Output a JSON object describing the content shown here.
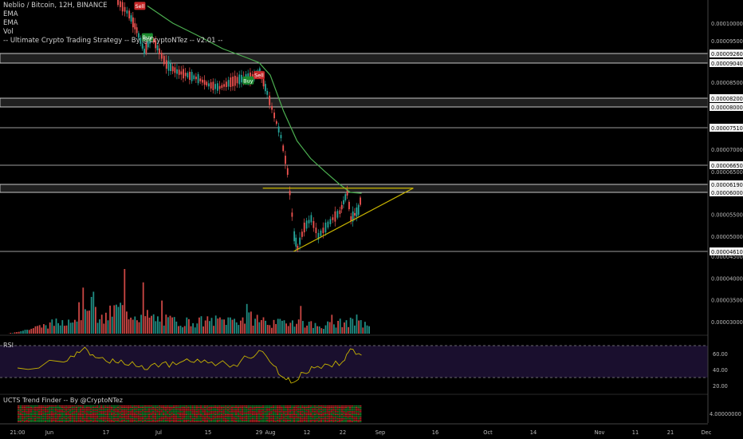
{
  "legend": {
    "symbol": "Neblio / Bitcoin, 12H, BINANCE",
    "ema1": "EMA",
    "ema2": "EMA",
    "vol": "Vol",
    "strategy": "-- Ultimate Crypto Trading Strategy -- By @CryptoNTez -- v2.01 --"
  },
  "rsi_label": "RSI",
  "trend_label": "UCTS Trend Finder -- By @CryptoNTez",
  "colors": {
    "up": "#26a69a",
    "down": "#ef5350",
    "ema": "#4caf50",
    "triangle": "#c8b400",
    "rsi": "#c8b400",
    "rsi_band": "#1a0f2e",
    "zone": "#b0b0b0",
    "buy": "#1b8a2e",
    "sell": "#c62828"
  },
  "chart_data": [
    {
      "type": "candlestick",
      "title": "Neblio / Bitcoin, 12H, BINANCE",
      "x_ticks": [
        "21:00",
        "Jun",
        "17",
        "Jul",
        "15",
        "29",
        "Aug",
        "12",
        "22",
        "Sep",
        "16",
        "Oct",
        "14",
        "Nov",
        "11",
        "21",
        "Dec"
      ],
      "y_ticks": [
        "0.00010000",
        "0.00009500",
        "0.00009260",
        "0.00009040",
        "0.00008500",
        "0.00008200",
        "0.00008000",
        "0.00007510",
        "0.00007000",
        "0.00006650",
        "0.00006500",
        "0.00006190",
        "0.00006000",
        "0.00005500",
        "0.00005000",
        "0.00004610",
        "0.00004500",
        "0.00004000",
        "0.00003500",
        "0.00003000"
      ],
      "ylim": [
        2.8e-05,
        0.000105
      ],
      "horizontal_levels": [
        9.26e-05,
        9.04e-05,
        8.2e-05,
        8e-05,
        7.51e-05,
        6.65e-05,
        6.19e-05,
        6e-05,
        4.61e-05
      ],
      "zones": [
        [
          9.04e-05,
          9.26e-05
        ],
        [
          8e-05,
          8.2e-05
        ],
        [
          6e-05,
          6.19e-05
        ]
      ],
      "signals": [
        {
          "label": "Sell",
          "date": "2019-06-26",
          "price": 0.000104
        },
        {
          "label": "Buy",
          "date": "2019-06-28",
          "price": 9.6e-05
        },
        {
          "label": "Buy",
          "date": "2019-07-26",
          "price": 8.55e-05
        },
        {
          "label": "Sell",
          "date": "2019-07-29",
          "price": 8.7e-05
        }
      ],
      "trendlines": [
        {
          "name": "resistance",
          "from": [
            "2019-07-30",
            6.1e-05
          ],
          "to": [
            "2019-09-10",
            6.1e-05
          ]
        },
        {
          "name": "support",
          "from": [
            "2019-08-08",
            4.61e-05
          ],
          "to": [
            "2019-09-10",
            6.1e-05
          ]
        }
      ],
      "price_path": [
        [
          "2019-06-20",
          0.000105
        ],
        [
          "2019-06-23",
          0.000102
        ],
        [
          "2019-06-25",
          9.8e-05
        ],
        [
          "2019-06-27",
          9.3e-05
        ],
        [
          "2019-06-29",
          9.6e-05
        ],
        [
          "2019-07-01",
          9.3e-05
        ],
        [
          "2019-07-03",
          9e-05
        ],
        [
          "2019-07-06",
          8.8e-05
        ],
        [
          "2019-07-09",
          8.7e-05
        ],
        [
          "2019-07-12",
          8.6e-05
        ],
        [
          "2019-07-15",
          8.45e-05
        ],
        [
          "2019-07-18",
          8.4e-05
        ],
        [
          "2019-07-21",
          8.5e-05
        ],
        [
          "2019-07-24",
          8.6e-05
        ],
        [
          "2019-07-27",
          8.65e-05
        ],
        [
          "2019-07-29",
          8.8e-05
        ],
        [
          "2019-07-31",
          8.3e-05
        ],
        [
          "2019-08-02",
          7.8e-05
        ],
        [
          "2019-08-04",
          7.3e-05
        ],
        [
          "2019-08-06",
          6.5e-05
        ],
        [
          "2019-08-08",
          5e-05
        ],
        [
          "2019-08-09",
          4.7e-05
        ],
        [
          "2019-08-11",
          5.2e-05
        ],
        [
          "2019-08-13",
          5.4e-05
        ],
        [
          "2019-08-15",
          5e-05
        ],
        [
          "2019-08-17",
          5.2e-05
        ],
        [
          "2019-08-19",
          5.4e-05
        ],
        [
          "2019-08-21",
          5.55e-05
        ],
        [
          "2019-08-23",
          6e-05
        ],
        [
          "2019-08-24",
          5.4e-05
        ],
        [
          "2019-08-26",
          5.6e-05
        ],
        [
          "2019-08-27",
          6e-05
        ]
      ],
      "ema_path": [
        [
          "2019-06-28",
          0.000104
        ],
        [
          "2019-07-05",
          0.0001
        ],
        [
          "2019-07-12",
          9.65e-05
        ],
        [
          "2019-07-19",
          9.35e-05
        ],
        [
          "2019-07-26",
          9.15e-05
        ],
        [
          "2019-07-29",
          9.05e-05
        ],
        [
          "2019-08-01",
          8.7e-05
        ],
        [
          "2019-08-05",
          7.9e-05
        ],
        [
          "2019-08-09",
          7.2e-05
        ],
        [
          "2019-08-13",
          6.8e-05
        ],
        [
          "2019-08-17",
          6.5e-05
        ],
        [
          "2019-08-21",
          6.2e-05
        ],
        [
          "2019-08-24",
          6e-05
        ],
        [
          "2019-08-27",
          5.98e-05
        ]
      ],
      "volume_path": [
        [
          "2019-06-01",
          0.2
        ],
        [
          "2019-06-08",
          0.35
        ],
        [
          "2019-06-12",
          1.0
        ],
        [
          "2019-06-15",
          0.25
        ],
        [
          "2019-06-20",
          0.6
        ],
        [
          "2019-07-01",
          0.3
        ],
        [
          "2019-07-10",
          0.25
        ],
        [
          "2019-07-20",
          0.3
        ],
        [
          "2019-07-28",
          0.35
        ],
        [
          "2019-08-02",
          0.2
        ],
        [
          "2019-08-08",
          0.3
        ],
        [
          "2019-08-15",
          0.15
        ],
        [
          "2019-08-23",
          0.25
        ],
        [
          "2019-08-27",
          0.2
        ]
      ]
    },
    {
      "type": "line",
      "title": "RSI",
      "y_ticks": [
        "60.00",
        "40.00",
        "20.00"
      ],
      "ylim": [
        10,
        80
      ],
      "bands": [
        70,
        30
      ],
      "x": [
        "2019-05-31",
        "2019-06-04",
        "2019-06-08",
        "2019-06-11",
        "2019-06-14",
        "2019-06-18",
        "2019-06-21",
        "2019-06-25",
        "2019-06-28",
        "2019-07-02",
        "2019-07-06",
        "2019-07-10",
        "2019-07-14",
        "2019-07-18",
        "2019-07-22",
        "2019-07-26",
        "2019-07-29",
        "2019-08-02",
        "2019-08-05",
        "2019-08-08",
        "2019-08-11",
        "2019-08-14",
        "2019-08-18",
        "2019-08-22",
        "2019-08-24",
        "2019-08-27"
      ],
      "values": [
        42,
        50,
        56,
        68,
        55,
        48,
        52,
        44,
        40,
        48,
        46,
        50,
        52,
        48,
        46,
        55,
        64,
        45,
        30,
        24,
        36,
        42,
        46,
        50,
        66,
        58
      ]
    },
    {
      "type": "heatmap",
      "title": "UCTS Trend Finder -- By @CryptoNTez",
      "y_ticks": [
        "4.00000000"
      ],
      "rows": 12,
      "x_range": [
        "2019-05-31",
        "2019-08-27"
      ]
    }
  ]
}
